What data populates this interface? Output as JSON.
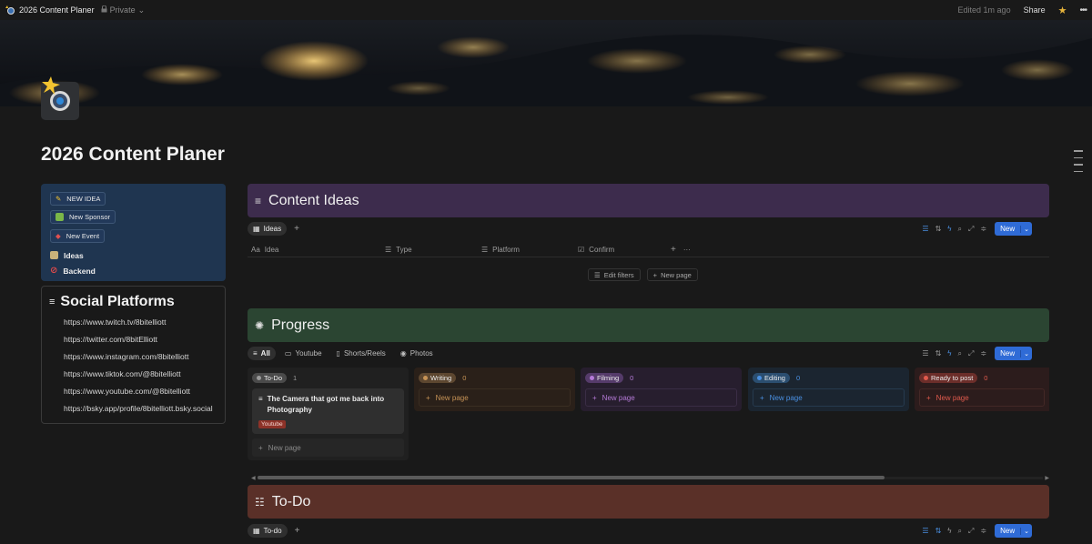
{
  "topbar": {
    "title": "2026 Content Planer",
    "privacy": "Private",
    "edited": "Edited 1m ago",
    "share": "Share"
  },
  "page": {
    "title": "2026 Content Planer"
  },
  "nav_panel": {
    "buttons": [
      "NEW IDEA",
      "New Sponsor",
      "New Event"
    ],
    "links": [
      "Ideas",
      "Backend"
    ]
  },
  "social": {
    "title": "Social Platforms",
    "links": [
      "https://www.twitch.tv/8bitelliott",
      "https://twitter.com/8bitElliott",
      "https://www.instagram.com/8bitelliott",
      "https://www.tiktok.com/@8bitelliott",
      "https://www.youtube.com/@8bitelliott",
      "https://bsky.app/profile/8bitelliott.bsky.social"
    ]
  },
  "ideas": {
    "title": "Content Ideas",
    "view_tab": "Ideas",
    "columns": [
      "Idea",
      "Type",
      "Platform",
      "Confirm"
    ],
    "edit_filters": "Edit filters",
    "new_page": "New page",
    "new_button": "New"
  },
  "progress": {
    "title": "Progress",
    "tabs": [
      "All",
      "Youtube",
      "Shorts/Reels",
      "Photos"
    ],
    "new_button": "New",
    "columns": [
      {
        "label": "To-Do",
        "count": "1",
        "new_page": "New page"
      },
      {
        "label": "Writing",
        "count": "0",
        "new_page": "New page"
      },
      {
        "label": "Filming",
        "count": "0",
        "new_page": "New page"
      },
      {
        "label": "Editing",
        "count": "0",
        "new_page": "New page"
      },
      {
        "label": "Ready to post",
        "count": "0",
        "new_page": "New page"
      }
    ],
    "card": {
      "title": "The Camera that got me back into Photography",
      "tag": "Youtube"
    }
  },
  "todo": {
    "title": "To-Do",
    "view_tab": "To-do",
    "new_button": "New"
  },
  "colors": {
    "ideas_header": "#3d2c4d",
    "progress_header": "#2b4532",
    "todo_header": "#5a3028",
    "nav_panel": "#1f3550",
    "accent_blue": "#2f6bd6"
  }
}
